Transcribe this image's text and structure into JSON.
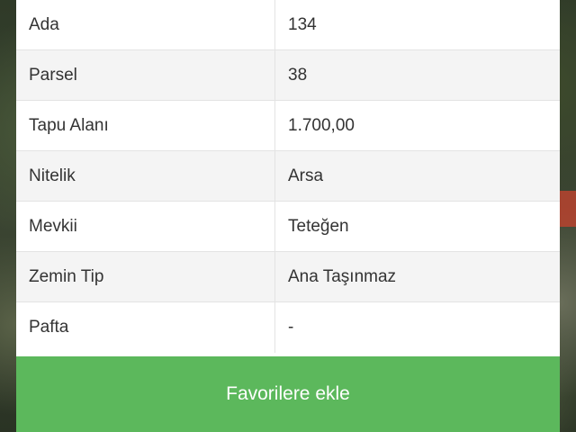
{
  "parcel_info": {
    "rows": [
      {
        "label": "Ada",
        "value": "134"
      },
      {
        "label": "Parsel",
        "value": "38"
      },
      {
        "label": "Tapu Alanı",
        "value": "1.700,00"
      },
      {
        "label": "Nitelik",
        "value": "Arsa"
      },
      {
        "label": "Mevkii",
        "value": "Teteğen"
      },
      {
        "label": "Zemin Tip",
        "value": "Ana Taşınmaz"
      },
      {
        "label": "Pafta",
        "value": "-"
      }
    ]
  },
  "actions": {
    "favorite_label": "Favorilere ekle"
  },
  "colors": {
    "button_bg": "#5cb85c",
    "row_shade": "#f4f4f4",
    "text": "#333333"
  }
}
